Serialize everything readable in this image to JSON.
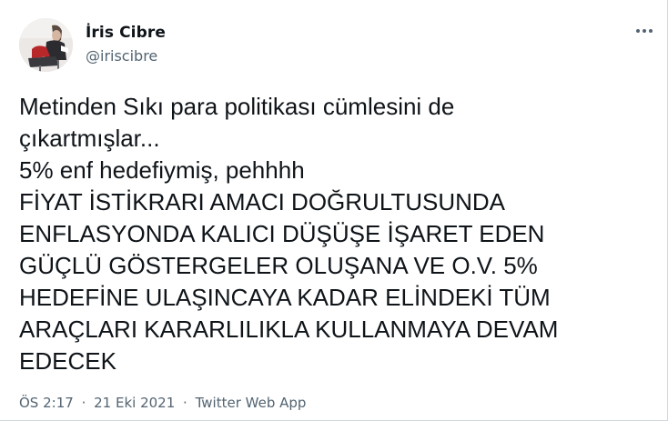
{
  "author": {
    "name": "İris Cibre",
    "handle": "@iriscibre"
  },
  "icons": {
    "more": "more-horizontal-icon",
    "avatar": "profile-photo"
  },
  "tweet": {
    "lines": [
      "Metinden Sıkı para politikası cümlesini de",
      "çıkartmışlar...",
      "5% enf hedefiymiş, pehhhh",
      "FİYAT İSTİKRARI AMACI DOĞRULTUSUNDA",
      "ENFLASYONDA KALICI DÜŞÜŞE İŞARET EDEN",
      "GÜÇLÜ GÖSTERGELER OLUŞANA VE O.V. 5%",
      "HEDEFİNE ULAŞINCAYA KADAR ELİNDEKİ TÜM",
      "ARAÇLARI KARARLILIKLA KULLANMAYA DEVAM",
      "EDECEK"
    ]
  },
  "meta": {
    "time": "ÖS 2:17",
    "date": "21 Eki 2021",
    "separator": "·",
    "source": "Twitter Web App"
  },
  "colors": {
    "text": "#0f1419",
    "secondary": "#536471",
    "border": "#cfd9de"
  }
}
